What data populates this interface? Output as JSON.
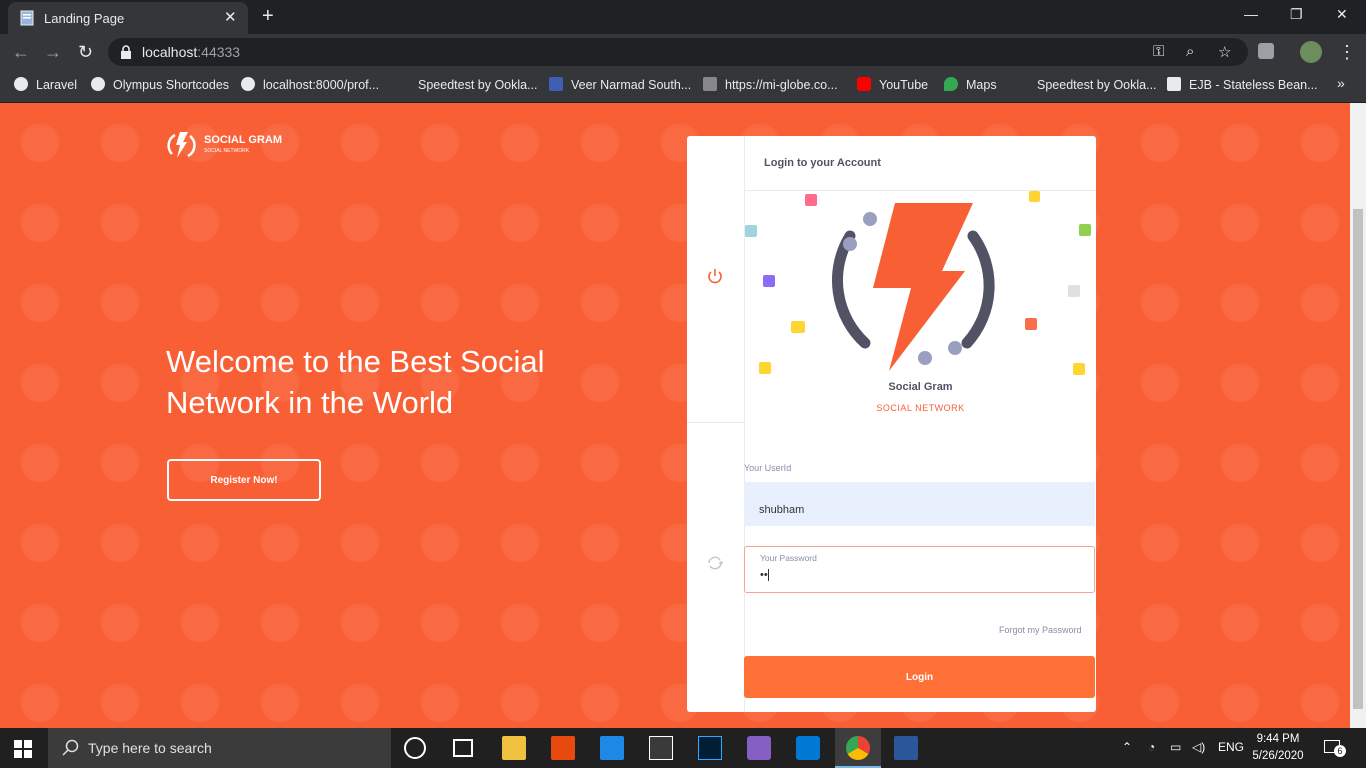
{
  "browser": {
    "tab_title": "Landing Page",
    "url_host": "localhost",
    "url_port": ":44333",
    "bookmarks": [
      {
        "label": "Laravel",
        "icon": "globe-icon"
      },
      {
        "label": "Olympus Shortcodes",
        "icon": "globe-icon"
      },
      {
        "label": "localhost:8000/prof...",
        "icon": "globe-icon"
      },
      {
        "label": "Speedtest by Ookla...",
        "icon": "speedtest-icon"
      },
      {
        "label": "Veer Narmad South...",
        "icon": "c-icon"
      },
      {
        "label": "https://mi-globe.co...",
        "icon": "mi-icon"
      },
      {
        "label": "YouTube",
        "icon": "youtube-icon"
      },
      {
        "label": "Maps",
        "icon": "maps-icon"
      },
      {
        "label": "Speedtest by Ookla...",
        "icon": "speedtest-icon"
      },
      {
        "label": "EJB - Stateless Bean...",
        "icon": "java-icon"
      }
    ],
    "more_bookmarks": "»"
  },
  "landing": {
    "brand_name": "SOCIAL GRAM",
    "brand_tagline": "SOCIAL NETWORK",
    "headline": "Welcome to the Best Social Network in the World",
    "register_label": "Register Now!"
  },
  "login_card": {
    "title": "Login to your Account",
    "app_name": "Social Gram",
    "app_tagline": "SOCIAL NETWORK",
    "userid_label": "Your UserId",
    "userid_value": "shubham",
    "password_label": "Your Password",
    "password_value": "••",
    "forgot_label": "Forgot my Password",
    "login_label": "Login"
  },
  "taskbar": {
    "search_placeholder": "Type here to search",
    "language": "ENG",
    "time": "9:44 PM",
    "date": "5/26/2020",
    "notifications": "6"
  },
  "colors": {
    "brand": "#f95f35",
    "button": "#ff7037",
    "chrome_dark": "#202124",
    "chrome_mid": "#35363a"
  }
}
